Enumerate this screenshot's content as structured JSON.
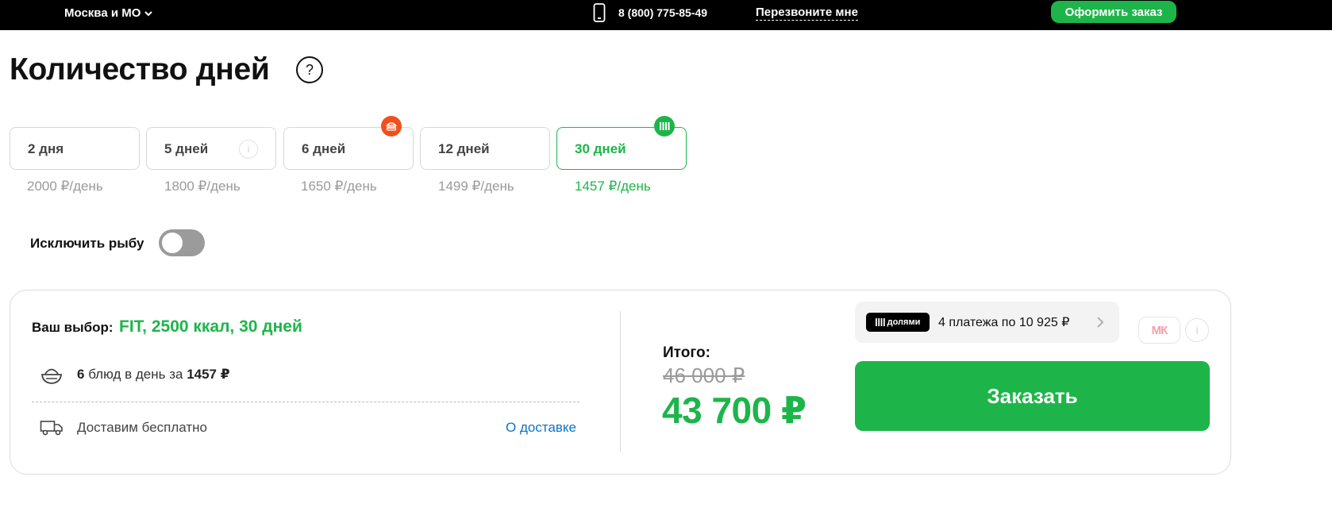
{
  "header": {
    "region": "Москва и МО",
    "phone": "8 (800) 775-85-49",
    "callback": "Перезвоните мне",
    "order_button": "Оформить заказ"
  },
  "title": "Количество дней",
  "help_icon": "question-mark-icon",
  "days": [
    {
      "label": "2 дня",
      "price": "2000 ₽/день",
      "selected": false
    },
    {
      "label": "5 дней",
      "price": "1800 ₽/день",
      "selected": false,
      "icon": "info-icon"
    },
    {
      "label": "6 дней",
      "price": "1650 ₽/день",
      "selected": false,
      "badge": "burger-icon",
      "badge_color": "#f0501e"
    },
    {
      "label": "12 дней",
      "price": "1499 ₽/день",
      "selected": false
    },
    {
      "label": "30 дней",
      "price": "1457 ₽/день",
      "selected": true,
      "badge": "dolyami-icon",
      "badge_color": "#1db54a"
    }
  ],
  "exclude_fish": {
    "label": "Исключить рыбу",
    "enabled": false
  },
  "summary": {
    "choice_label": "Ваш выбор:",
    "choice_value": "FIT, 2500 ккал, 30 дней",
    "meals_count": "6",
    "meals_mid": " блюд в день за ",
    "meals_price": "1457 ₽",
    "delivery": "Доставим бесплатно",
    "delivery_link": "О доставке",
    "total_label": "Итого:",
    "old_price": "46 000  ₽",
    "new_price": "43 700 ₽",
    "installment_brand": "долями",
    "installment_text": "4 платежа по 10 925 ₽",
    "mk_logo": "МК",
    "order_button": "Заказать"
  },
  "colors": {
    "accent": "#1db54a",
    "badge_orange": "#f0501e",
    "link": "#0b73c4",
    "muted": "#9a9a9a"
  }
}
